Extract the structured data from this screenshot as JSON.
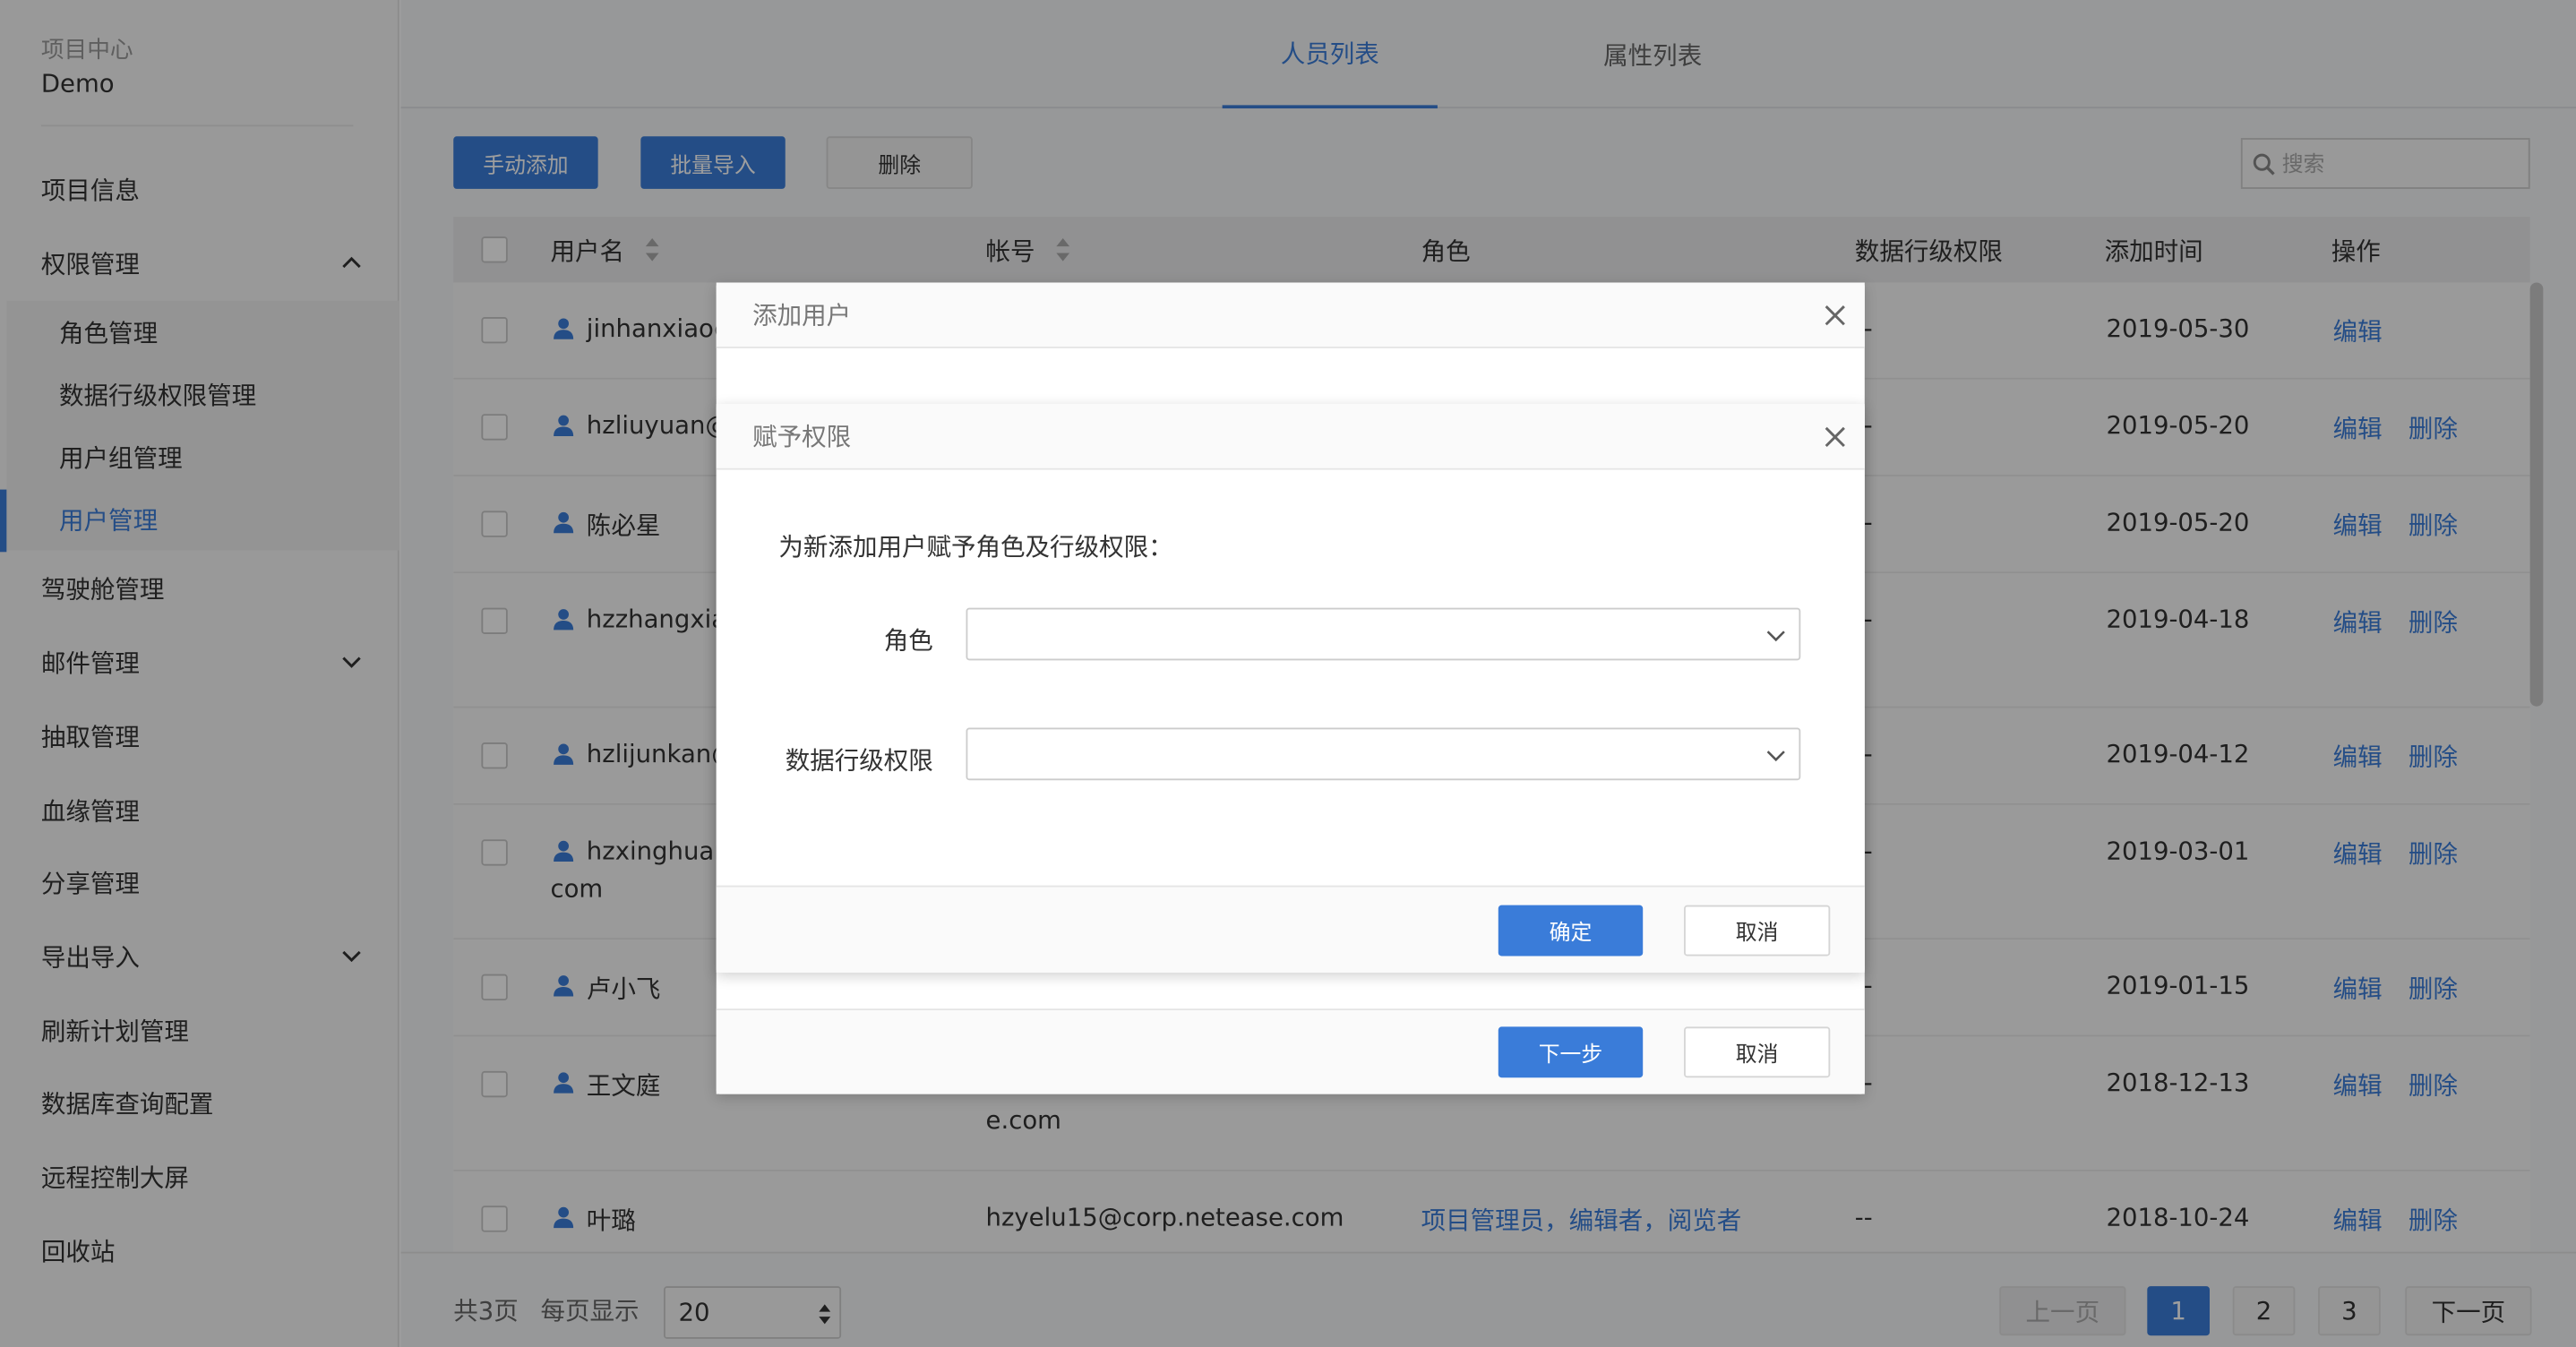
{
  "sidebar": {
    "project_label": "项目中心",
    "project_name": "Demo",
    "items": [
      {
        "label": "项目信息"
      },
      {
        "label": "权限管理"
      },
      {
        "label": "驾驶舱管理"
      },
      {
        "label": "邮件管理"
      },
      {
        "label": "抽取管理"
      },
      {
        "label": "血缘管理"
      },
      {
        "label": "分享管理"
      },
      {
        "label": "导出导入"
      },
      {
        "label": "刷新计划管理"
      },
      {
        "label": "数据库查询配置"
      },
      {
        "label": "远程控制大屏"
      },
      {
        "label": "回收站"
      }
    ],
    "subitems": [
      {
        "label": "角色管理"
      },
      {
        "label": "数据行级权限管理"
      },
      {
        "label": "用户组管理"
      },
      {
        "label": "用户管理"
      }
    ]
  },
  "tabs": [
    {
      "label": "人员列表"
    },
    {
      "label": "属性列表"
    }
  ],
  "toolbar": {
    "manual_add": "手动添加",
    "batch_import": "批量导入",
    "delete": "删除",
    "search_placeholder": "搜索"
  },
  "table": {
    "headers": {
      "username": "用户名",
      "account": "帐号",
      "role": "角色",
      "row_permission": "数据行级权限",
      "added_time": "添加时间",
      "actions": "操作"
    },
    "rows": [
      {
        "name": "jinhanxiao@",
        "name2": "",
        "account": "",
        "account2": "",
        "role": "",
        "perm": "--",
        "date": "2019-05-30",
        "edit": "编辑",
        "del": ""
      },
      {
        "name": "hzliuyuan@",
        "name2": "",
        "account": "",
        "account2": "",
        "role": "",
        "perm": "--",
        "date": "2019-05-20",
        "edit": "编辑",
        "del": "删除"
      },
      {
        "name": "陈必星",
        "name2": "",
        "account": "",
        "account2": "",
        "role": "",
        "perm": "--",
        "date": "2019-05-20",
        "edit": "编辑",
        "del": "删除"
      },
      {
        "name": "hzzhangxia",
        "name2": "",
        "account": "",
        "account2": "",
        "role": "",
        "perm": "--",
        "date": "2019-04-18",
        "edit": "编辑",
        "del": "删除"
      },
      {
        "name": "hzlijunkan@",
        "name2": "",
        "account": "",
        "account2": "",
        "role": "",
        "perm": "--",
        "date": "2019-04-12",
        "edit": "编辑",
        "del": "删除"
      },
      {
        "name": "hzxinghuan",
        "name2": "com",
        "account": "",
        "account2": "",
        "role": "",
        "perm": "--",
        "date": "2019-03-01",
        "edit": "编辑",
        "del": "删除"
      },
      {
        "name": "卢小飞",
        "name2": "",
        "account": "",
        "account2": "",
        "role": "",
        "perm": "--",
        "date": "2019-01-15",
        "edit": "编辑",
        "del": "删除"
      },
      {
        "name": "王文庭",
        "name2": "",
        "account": "",
        "account2": "e.com",
        "role": "",
        "perm": "--",
        "date": "2018-12-13",
        "edit": "编辑",
        "del": "删除"
      },
      {
        "name": "叶璐",
        "name2": "",
        "account": "hzyelu15@corp.netease.com",
        "account2": "",
        "role": "项目管理员，编辑者，阅览者",
        "perm": "--",
        "date": "2018-10-24",
        "edit": "编辑",
        "del": "删除"
      }
    ]
  },
  "pagination": {
    "total_pages": "共3页",
    "per_page_label": "每页显示",
    "per_page_value": "20",
    "prev": "上一页",
    "pages": [
      "1",
      "2",
      "3"
    ],
    "current": "1",
    "next": "下一页"
  },
  "modal_add_user": {
    "title": "添加用户",
    "next": "下一步",
    "cancel": "取消"
  },
  "modal_grant": {
    "title": "赋予权限",
    "intro": "为新添加用户赋予角色及行级权限：",
    "role_label": "角色",
    "role_value": "",
    "perm_label": "数据行级权限",
    "perm_value": "",
    "confirm": "确定",
    "cancel": "取消"
  },
  "colors": {
    "accent": "#3a7cd9",
    "overlay": "rgba(0,0,0,0.38)"
  }
}
